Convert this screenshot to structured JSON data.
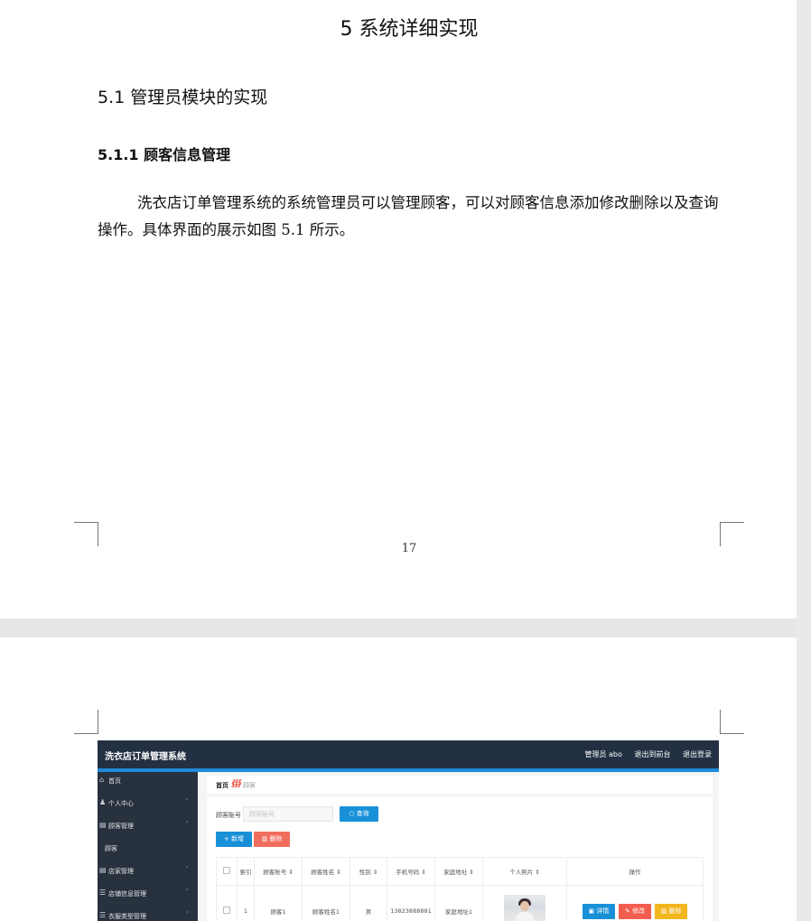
{
  "document": {
    "chapter_title": "5 系统详细实现",
    "section_title": "5.1  管理员模块的实现",
    "subsection_title": "5.1.1  顾客信息管理",
    "paragraph": "洗衣店订单管理系统的系统管理员可以管理顾客，可以对顾客信息添加修改删除以及查询操作。具体界面的展示如图 5.1 所示。",
    "page_number": "17"
  },
  "screenshot": {
    "app_title": "洗衣店订单管理系统",
    "header_links": [
      "管理员 abo",
      "退出到前台",
      "退出登录"
    ],
    "sidebar": [
      {
        "icon": "home-icon",
        "glyph": "⌂",
        "label": "首页",
        "chevron": ""
      },
      {
        "icon": "user-icon",
        "glyph": "♟",
        "label": "个人中心",
        "chevron": "˅"
      },
      {
        "icon": "list-icon",
        "glyph": "▤",
        "label": "顾客管理",
        "chevron": "˄"
      },
      {
        "icon": "",
        "glyph": "",
        "label": "顾客",
        "chevron": ""
      },
      {
        "icon": "list-icon",
        "glyph": "▤",
        "label": "店家管理",
        "chevron": "˅"
      },
      {
        "icon": "menu-icon",
        "glyph": "☰",
        "label": "店铺信息管理",
        "chevron": "˅"
      },
      {
        "icon": "menu-icon",
        "glyph": "☰",
        "label": "衣服类型管理",
        "chevron": "˅"
      }
    ],
    "breadcrumb": {
      "home": "首页",
      "current": "顾客"
    },
    "search": {
      "label": "顾客账号",
      "placeholder": "顾客账号",
      "button": "查询"
    },
    "actions": {
      "add": "新增",
      "delete": "删除"
    },
    "table": {
      "headers": [
        "",
        "索引",
        "顾客账号",
        "顾客姓名",
        "性别",
        "手机号码",
        "家庭地址",
        "个人照片",
        "操作"
      ],
      "rows": [
        {
          "index": "1",
          "account": "顾客1",
          "name": "顾客姓名1",
          "gender": "男",
          "phone": "13823888881",
          "address": "家庭地址1"
        }
      ],
      "row_buttons": {
        "detail": "详情",
        "edit": "修改",
        "delete": "删除"
      }
    },
    "colors": {
      "topbar": "#233043",
      "sidebar": "#28323f",
      "accent": "#1890d8",
      "danger": "#f06d5d",
      "warning": "#f2b61f"
    }
  }
}
